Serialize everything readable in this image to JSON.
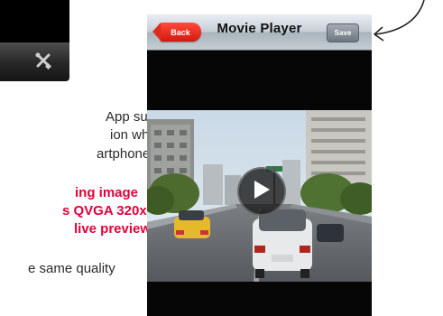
{
  "description_lines": [
    "App supports",
    "ion while you",
    "artphone."
  ],
  "highlight_lines": [
    "ing image",
    "s QVGA 320x",
    "live preview"
  ],
  "footer_line": "e same quality",
  "player": {
    "back_label": "Back",
    "title": "Movie Player",
    "save_label": "Save"
  },
  "icons": {
    "toolbar": "wrench-icon",
    "play": "play-icon",
    "annotation": "curved-arrow-icon"
  },
  "colors": {
    "highlight": "#e5003a",
    "back_button": "#e02a1f"
  }
}
